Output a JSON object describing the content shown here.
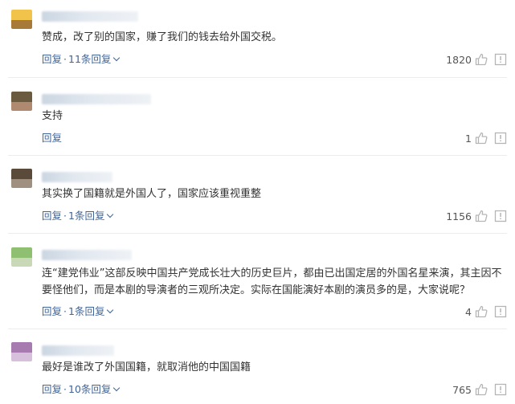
{
  "comments": [
    {
      "text": "赞成，改了别的国家，赚了我们的钱去给外国交税。",
      "reply_label": "回复",
      "replies_label": "11条回复",
      "likes": "1820",
      "avatar_colors": [
        "#f2c34a",
        "#a87a3a"
      ]
    },
    {
      "text": "支持",
      "reply_label": "回复",
      "likes": "1",
      "avatar_colors": [
        "#6a5a40",
        "#b08a70"
      ]
    },
    {
      "text": "其实换了国籍就是外国人了，国家应该重视重整",
      "reply_label": "回复",
      "replies_label": "1条回复",
      "likes": "1156",
      "avatar_colors": [
        "#5a4a3a",
        "#a09080"
      ]
    },
    {
      "text": "连“建党伟业”这部反映中国共产党成长壮大的历史巨片，都由已出国定居的外国名星来演，其主因不要怪他们，而是本剧的导演者的三观所决定。实际在国能演好本剧的演员多的是，大家说呢？",
      "reply_label": "回复",
      "replies_label": "1条回复",
      "likes": "4",
      "avatar_colors": [
        "#8fbf70",
        "#c9d9b8"
      ]
    },
    {
      "text": "最好是谁改了外国国籍，就取消他的中国国籍",
      "reply_label": "回复",
      "replies_label": "10条回复",
      "likes": "765",
      "avatar_colors": [
        "#a77ab0",
        "#d6c0dc"
      ]
    }
  ],
  "colors": {
    "link": "#406599",
    "text": "#333333",
    "icon": "#b5b5b5"
  },
  "icons": {
    "like": "thumbs-up-icon",
    "report": "report-icon",
    "expand": "chevron-down-icon"
  }
}
